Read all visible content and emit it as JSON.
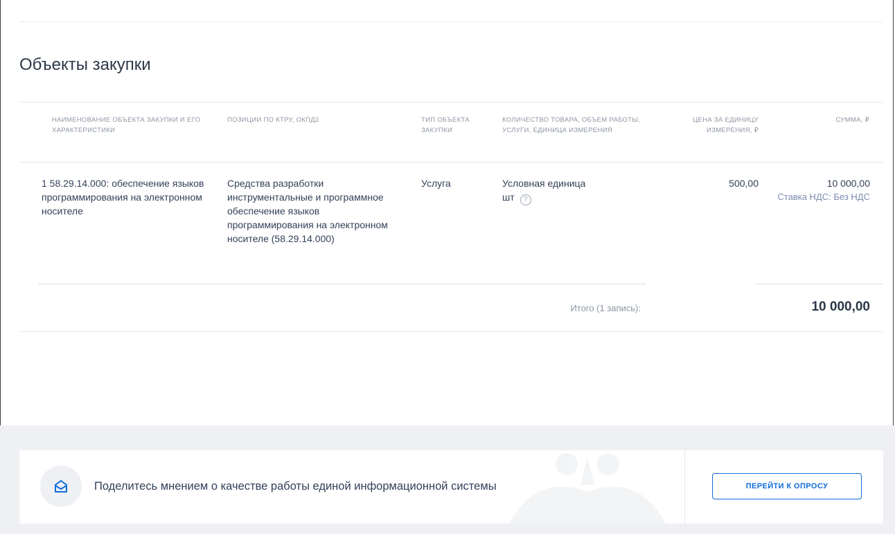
{
  "section": {
    "title": "Объекты закупки"
  },
  "table": {
    "headers": {
      "name": "НАИМЕНОВАНИЕ ОБЪЕКТА ЗАКУПКИ И ЕГО ХАРАКТЕРИСТИКИ",
      "positions": "ПОЗИЦИИ ПО КТРУ, ОКПД2",
      "type": "ТИП ОБЪЕКТА ЗАКУПКИ",
      "quantity": "КОЛИЧЕСТВО ТОВАРА, ОБЪЕМ РАБОТЫ, УСЛУГИ, ЕДИНИЦА ИЗМЕРЕНИЯ",
      "unit_price": "ЦЕНА ЗА ЕДИНИЦУ ИЗМЕРЕНИЯ, ₽",
      "sum": "СУММА, ₽"
    },
    "rows": [
      {
        "name": "1 58.29.14.000: обеспечение языков программирования на электронном носителе",
        "positions": "Средства разработки инструментальные и программное обеспечение языков программирования на электронном носителе (58.29.14.000)",
        "type": "Услуга",
        "quantity_unit": "Условная единица",
        "quantity_abbr": "шт",
        "help_icon": "question-circle-icon",
        "unit_price": "500,00",
        "sum": "10 000,00",
        "vat": "Ставка НДС: Без НДС"
      }
    ],
    "total": {
      "label": "Итого (1 запись):",
      "value": "10 000,00"
    }
  },
  "survey": {
    "icon": "envelope-icon",
    "text": "Поделитесь мнением о качестве работы единой информационной системы",
    "button_label": "ПЕРЕЙТИ К ОПРОСУ"
  },
  "colors": {
    "accent": "#0d6bd9",
    "muted": "#8c95a3",
    "text": "#334059",
    "footer_bg": "#eef0f3"
  }
}
